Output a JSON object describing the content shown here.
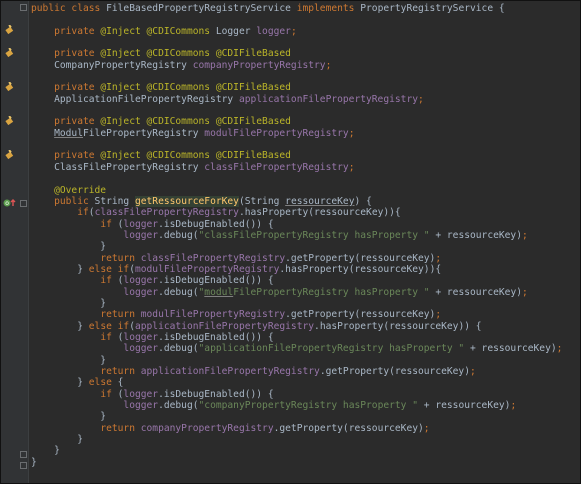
{
  "editor": {
    "lines": [
      [
        {
          "t": "public class ",
          "c": "kw"
        },
        {
          "t": "FileBasedPropertyRegistryService ",
          "c": "plain"
        },
        {
          "t": "implements ",
          "c": "kw"
        },
        {
          "t": "PropertyRegistryService {",
          "c": "plain"
        }
      ],
      [],
      [
        {
          "t": "    private ",
          "c": "kw"
        },
        {
          "t": "@Inject @CDICommons ",
          "c": "ann"
        },
        {
          "t": "Logger ",
          "c": "plain"
        },
        {
          "t": "logger",
          "c": "fld"
        },
        {
          "t": ";",
          "c": "kw"
        }
      ],
      [],
      [
        {
          "t": "    private ",
          "c": "kw"
        },
        {
          "t": "@Inject @CDICommons @CDIFileBased",
          "c": "ann"
        }
      ],
      [
        {
          "t": "    CompanyPropertyRegistry ",
          "c": "plain"
        },
        {
          "t": "companyPropertyRegistry",
          "c": "fld"
        },
        {
          "t": ";",
          "c": "kw"
        }
      ],
      [],
      [
        {
          "t": "    private ",
          "c": "kw"
        },
        {
          "t": "@Inject @CDICommons @CDIFileBased",
          "c": "ann"
        }
      ],
      [
        {
          "t": "    ApplicationFilePropertyRegistry ",
          "c": "plain"
        },
        {
          "t": "applicationFilePropertyRegistry",
          "c": "fld"
        },
        {
          "t": ";",
          "c": "kw"
        }
      ],
      [],
      [
        {
          "t": "    private ",
          "c": "kw"
        },
        {
          "t": "@Inject @CDICommons @CDIFileBased",
          "c": "ann"
        }
      ],
      [
        {
          "t": "    ",
          "c": "plain"
        },
        {
          "t": "Modul",
          "c": "plain u"
        },
        {
          "t": "FilePropertyRegistry ",
          "c": "plain"
        },
        {
          "t": "modulFilePropertyRegistry",
          "c": "fld"
        },
        {
          "t": ";",
          "c": "kw"
        }
      ],
      [],
      [
        {
          "t": "    private ",
          "c": "kw"
        },
        {
          "t": "@Inject @CDICommons @CDIFileBased",
          "c": "ann"
        }
      ],
      [
        {
          "t": "    ClassFilePropertyRegistry ",
          "c": "plain"
        },
        {
          "t": "classFilePropertyRegistry",
          "c": "fld"
        },
        {
          "t": ";",
          "c": "kw"
        }
      ],
      [],
      [
        {
          "t": "    @Override",
          "c": "ann"
        }
      ],
      [
        {
          "t": "    public ",
          "c": "kw"
        },
        {
          "t": "String ",
          "c": "plain"
        },
        {
          "t": "getRessourceForKey",
          "c": "mth-hl"
        },
        {
          "t": "(String ",
          "c": "plain"
        },
        {
          "t": "ressourceKey",
          "c": "plain u"
        },
        {
          "t": ") {",
          "c": "plain"
        }
      ],
      [
        {
          "t": "        ",
          "c": "plain"
        },
        {
          "t": "if",
          "c": "kw"
        },
        {
          "t": "(",
          "c": "plain"
        },
        {
          "t": "classFilePropertyRegistry",
          "c": "fld"
        },
        {
          "t": ".hasProperty(ressourceKey)){",
          "c": "plain"
        }
      ],
      [
        {
          "t": "            ",
          "c": "plain"
        },
        {
          "t": "if ",
          "c": "kw"
        },
        {
          "t": "(",
          "c": "plain"
        },
        {
          "t": "logger",
          "c": "fld"
        },
        {
          "t": ".isDebugEnabled()) {",
          "c": "plain"
        }
      ],
      [
        {
          "t": "                ",
          "c": "plain"
        },
        {
          "t": "logger",
          "c": "fld"
        },
        {
          "t": ".debug(",
          "c": "plain"
        },
        {
          "t": "\"classFilePropertyRegistry hasProperty \"",
          "c": "str"
        },
        {
          "t": " + ressourceKey)",
          "c": "plain"
        },
        {
          "t": ";",
          "c": "kw"
        }
      ],
      [
        {
          "t": "            }",
          "c": "plain"
        }
      ],
      [
        {
          "t": "            ",
          "c": "plain"
        },
        {
          "t": "return ",
          "c": "kw"
        },
        {
          "t": "classFilePropertyRegistry",
          "c": "fld"
        },
        {
          "t": ".getProperty(ressourceKey)",
          "c": "plain"
        },
        {
          "t": ";",
          "c": "kw"
        }
      ],
      [
        {
          "t": "        } ",
          "c": "plain"
        },
        {
          "t": "else if",
          "c": "kw"
        },
        {
          "t": "(",
          "c": "plain"
        },
        {
          "t": "modulFilePropertyRegistry",
          "c": "fld"
        },
        {
          "t": ".hasProperty(ressourceKey)){",
          "c": "plain"
        }
      ],
      [
        {
          "t": "            ",
          "c": "plain"
        },
        {
          "t": "if ",
          "c": "kw"
        },
        {
          "t": "(",
          "c": "plain"
        },
        {
          "t": "logger",
          "c": "fld"
        },
        {
          "t": ".isDebugEnabled()) {",
          "c": "plain"
        }
      ],
      [
        {
          "t": "                ",
          "c": "plain"
        },
        {
          "t": "logger",
          "c": "fld"
        },
        {
          "t": ".debug(",
          "c": "plain"
        },
        {
          "t": "\"",
          "c": "str"
        },
        {
          "t": "modul",
          "c": "str u"
        },
        {
          "t": "FilePropertyRegistry hasProperty \"",
          "c": "str"
        },
        {
          "t": " + ressourceKey)",
          "c": "plain"
        },
        {
          "t": ";",
          "c": "kw"
        }
      ],
      [
        {
          "t": "            }",
          "c": "plain"
        }
      ],
      [
        {
          "t": "            ",
          "c": "plain"
        },
        {
          "t": "return ",
          "c": "kw"
        },
        {
          "t": "modulFilePropertyRegistry",
          "c": "fld"
        },
        {
          "t": ".getProperty(ressourceKey)",
          "c": "plain"
        },
        {
          "t": ";",
          "c": "kw"
        }
      ],
      [
        {
          "t": "        } ",
          "c": "plain"
        },
        {
          "t": "else if",
          "c": "kw"
        },
        {
          "t": "(",
          "c": "plain"
        },
        {
          "t": "applicationFilePropertyRegistry",
          "c": "fld"
        },
        {
          "t": ".hasProperty(ressourceKey)) {",
          "c": "plain"
        }
      ],
      [
        {
          "t": "            ",
          "c": "plain"
        },
        {
          "t": "if ",
          "c": "kw"
        },
        {
          "t": "(",
          "c": "plain"
        },
        {
          "t": "logger",
          "c": "fld"
        },
        {
          "t": ".isDebugEnabled()) {",
          "c": "plain"
        }
      ],
      [
        {
          "t": "                ",
          "c": "plain"
        },
        {
          "t": "logger",
          "c": "fld"
        },
        {
          "t": ".debug(",
          "c": "plain"
        },
        {
          "t": "\"applicationFilePropertyRegistry hasProperty \"",
          "c": "str"
        },
        {
          "t": " + ressourceKey)",
          "c": "plain"
        },
        {
          "t": ";",
          "c": "kw"
        }
      ],
      [
        {
          "t": "            }",
          "c": "plain"
        }
      ],
      [
        {
          "t": "            ",
          "c": "plain"
        },
        {
          "t": "return ",
          "c": "kw"
        },
        {
          "t": "applicationFilePropertyRegistry",
          "c": "fld"
        },
        {
          "t": ".getProperty(ressourceKey)",
          "c": "plain"
        },
        {
          "t": ";",
          "c": "kw"
        }
      ],
      [
        {
          "t": "        } ",
          "c": "plain"
        },
        {
          "t": "else ",
          "c": "kw"
        },
        {
          "t": "{",
          "c": "plain"
        }
      ],
      [
        {
          "t": "            ",
          "c": "plain"
        },
        {
          "t": "if ",
          "c": "kw"
        },
        {
          "t": "(",
          "c": "plain"
        },
        {
          "t": "logger",
          "c": "fld"
        },
        {
          "t": ".isDebugEnabled()) {",
          "c": "plain"
        }
      ],
      [
        {
          "t": "                ",
          "c": "plain"
        },
        {
          "t": "logger",
          "c": "fld"
        },
        {
          "t": ".debug(",
          "c": "plain"
        },
        {
          "t": "\"companyPropertyRegistry hasProperty \"",
          "c": "str"
        },
        {
          "t": " + ressourceKey)",
          "c": "plain"
        },
        {
          "t": ";",
          "c": "kw"
        }
      ],
      [
        {
          "t": "            }",
          "c": "plain"
        }
      ],
      [
        {
          "t": "            ",
          "c": "plain"
        },
        {
          "t": "return ",
          "c": "kw"
        },
        {
          "t": "companyPropertyRegistry",
          "c": "fld"
        },
        {
          "t": ".getProperty(ressourceKey)",
          "c": "plain"
        },
        {
          "t": ";",
          "c": "kw"
        }
      ],
      [
        {
          "t": "        }",
          "c": "plain"
        }
      ],
      [
        {
          "t": "    }",
          "c": "plain"
        }
      ],
      [
        {
          "t": "}",
          "c": "plain"
        }
      ]
    ]
  },
  "gutter": {
    "injection_icons": [
      "plug-icon",
      "plug-icon",
      "plug-icon",
      "plug-icon",
      "plug-icon"
    ],
    "override_icon": "override-method-icon"
  },
  "colors": {
    "background": "#2b2b2b",
    "gutter": "#313335",
    "keyword": "#cc7832",
    "annotation": "#bbb529",
    "field": "#9876aa",
    "string": "#6a8759",
    "text": "#a9b7c6",
    "method_highlight": "#344134"
  }
}
